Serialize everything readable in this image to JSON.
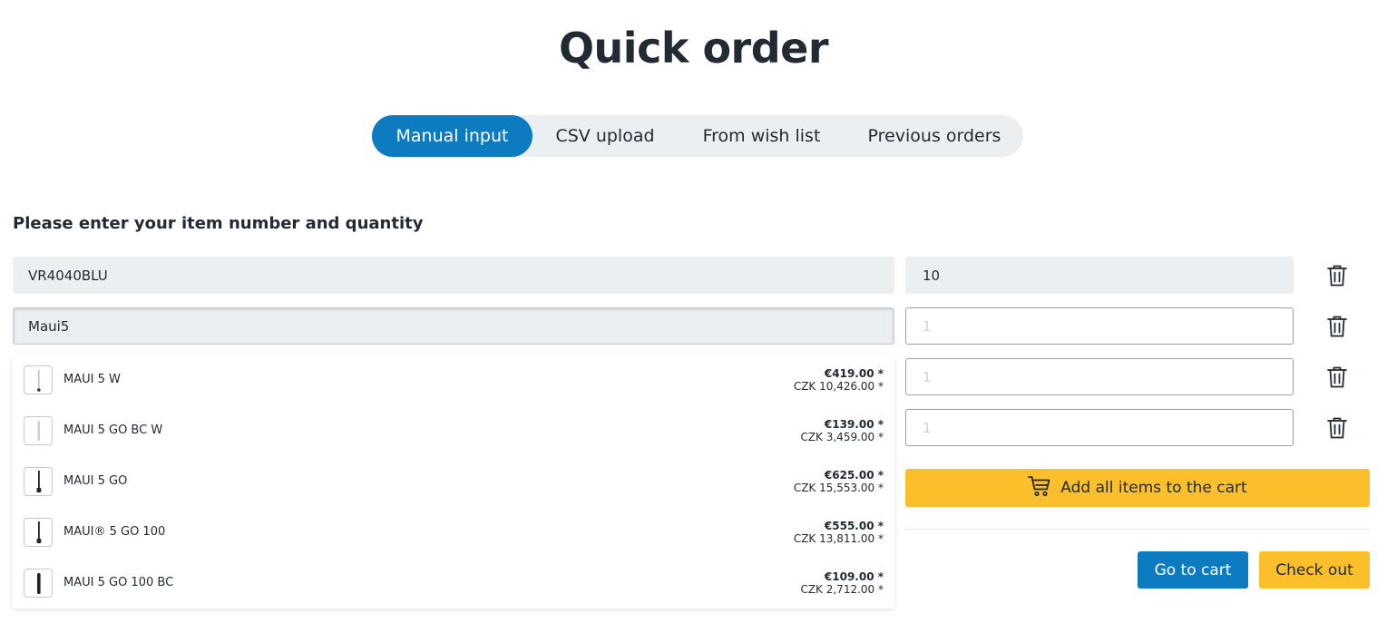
{
  "page": {
    "title": "Quick order"
  },
  "tabs": [
    {
      "label": "Manual input",
      "active": true
    },
    {
      "label": "CSV upload",
      "active": false
    },
    {
      "label": "From wish list",
      "active": false
    },
    {
      "label": "Previous orders",
      "active": false
    }
  ],
  "form": {
    "instruction": "Please enter your item number and quantity",
    "rows": [
      {
        "item_value": "VR4040BLU",
        "qty_value": "10",
        "qty_placeholder": "1"
      },
      {
        "item_value": "Maui5",
        "qty_value": "",
        "qty_placeholder": "1"
      },
      {
        "item_value": "",
        "qty_value": "",
        "qty_placeholder": "1"
      },
      {
        "item_value": "",
        "qty_value": "",
        "qty_placeholder": "1"
      }
    ]
  },
  "suggestions": [
    {
      "name": "MAUI 5 W",
      "price_eur": "€419.00 *",
      "price_czk": "CZK 10,426.00 *"
    },
    {
      "name": "MAUI 5 GO BC W",
      "price_eur": "€139.00 *",
      "price_czk": "CZK 3,459.00 *"
    },
    {
      "name": "MAUI 5 GO",
      "price_eur": "€625.00 *",
      "price_czk": "CZK 15,553.00 *"
    },
    {
      "name": "MAUI® 5 GO 100",
      "price_eur": "€555.00 *",
      "price_czk": "CZK 13,811.00 *"
    },
    {
      "name": "MAUI 5 GO 100 BC",
      "price_eur": "€109.00 *",
      "price_czk": "CZK 2,712.00 *"
    }
  ],
  "actions": {
    "add_all_label": "Add all items to the cart",
    "go_to_cart_label": "Go to cart",
    "checkout_label": "Check out"
  },
  "icons": {
    "trash": "trash-icon",
    "cart": "cart-icon",
    "product": "speaker-product-thumbnail"
  },
  "colors": {
    "primary": "#0c7bbf",
    "accent": "#fbbf2b",
    "input_bg": "#eceff2",
    "text": "#222a33"
  }
}
